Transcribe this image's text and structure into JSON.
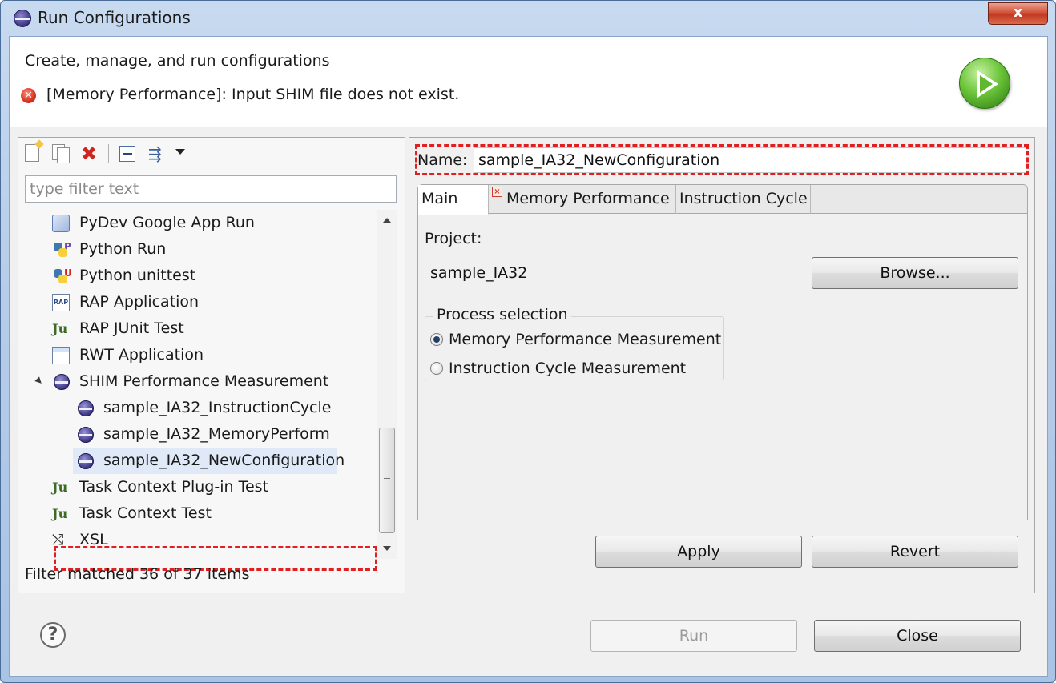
{
  "window": {
    "title": "Run Configurations",
    "close_glyph": "x"
  },
  "header": {
    "title": "Create, manage, and run configurations",
    "error_message": "[Memory Performance]: Input SHIM file does not exist.",
    "error_icon": "error-icon",
    "logo_icon": "run-icon"
  },
  "left": {
    "filter_placeholder": "type filter text",
    "tree": [
      {
        "label": "PyDev Google App Run"
      },
      {
        "label": "Python Run",
        "badge": "P"
      },
      {
        "label": "Python unittest",
        "badge": "U"
      },
      {
        "label": "RAP Application",
        "icon_text": "RAP"
      },
      {
        "label": "RAP JUnit Test",
        "icon_text": "Ju"
      },
      {
        "label": "RWT Application"
      },
      {
        "label": "SHIM Performance Measurement",
        "expanded": true
      },
      {
        "label": "sample_IA32_InstructionCycle"
      },
      {
        "label": "sample_IA32_MemoryPerform"
      },
      {
        "label": "sample_IA32_NewConfiguration",
        "selected": true
      },
      {
        "label": "Task Context Plug-in Test",
        "icon_text": "Ju"
      },
      {
        "label": "Task Context Test",
        "icon_text": "Ju"
      },
      {
        "label": "XSL",
        "icon_text": "⤭"
      }
    ],
    "filter_status": "Filter matched 36 of 37 items"
  },
  "right": {
    "name_label": "Name:",
    "name_value": "sample_IA32_NewConfiguration",
    "tabs": [
      {
        "label": "Main",
        "active": true
      },
      {
        "label": "Memory Performance",
        "has_error": true
      },
      {
        "label": "Instruction Cycle"
      }
    ],
    "project_label": "Project:",
    "project_value": "sample_IA32",
    "browse_label": "Browse...",
    "process_group": "Process selection",
    "radio_memory": "Memory Performance Measurement",
    "radio_instruction": "Instruction Cycle Measurement",
    "radio_selected": "Memory Performance Measurement",
    "apply_label": "Apply",
    "revert_label": "Revert"
  },
  "footer": {
    "help_glyph": "?",
    "run_label": "Run",
    "run_enabled": false,
    "close_label": "Close"
  },
  "colors": {
    "highlight_dash": "#e02020",
    "error": "#d5331f",
    "title_bar": "#b7cde9"
  }
}
